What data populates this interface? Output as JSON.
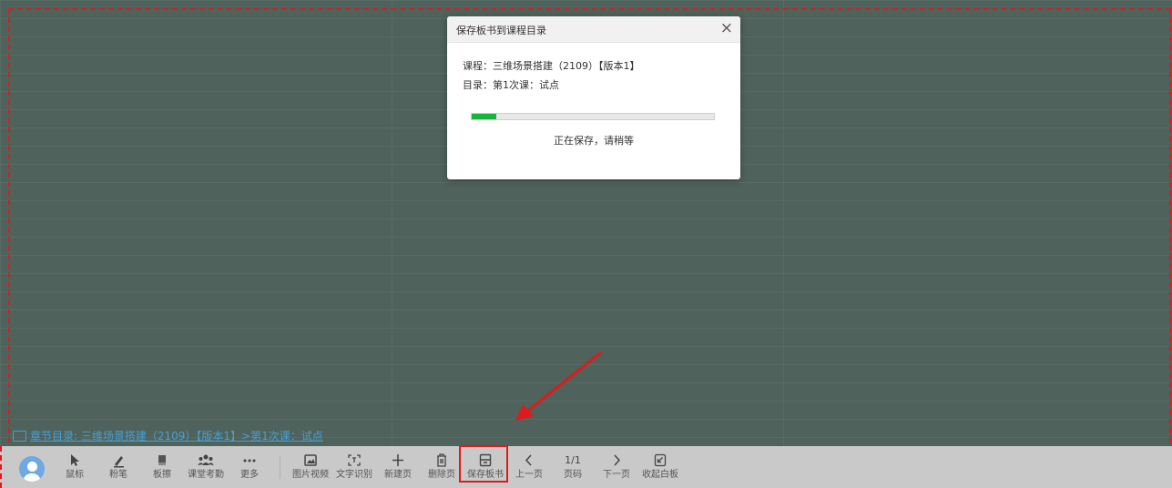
{
  "dialog": {
    "title": "保存板书到课程目录",
    "close_icon": "×",
    "course_line": "课程：三维场景搭建（2109）【版本1】",
    "catalog_line": "目录：第1次课：试点",
    "progress_fraction": 0.1,
    "status_text": "正在保存，请稍等"
  },
  "chapter_link": "章节目录: 三维场景搭建（2109）【版本1】>第1次课：试点",
  "toolbar": {
    "mouse": {
      "icon": "cursor-arrow-icon",
      "label": "鼠标"
    },
    "chalk": {
      "icon": "chalk-pen-icon",
      "label": "粉笔"
    },
    "eraser": {
      "icon": "eraser-icon",
      "label": "板擦"
    },
    "attendance": {
      "icon": "people-icon",
      "label": "课堂考勤"
    },
    "more": {
      "icon": "more-dots-icon",
      "label": "更多"
    },
    "media": {
      "icon": "image-video-icon",
      "label": "图片视频"
    },
    "ocr": {
      "icon": "text-recognition-icon",
      "label": "文字识别"
    },
    "new_page": {
      "icon": "plus-icon",
      "label": "新建页"
    },
    "delete_page": {
      "icon": "trash-icon",
      "label": "删除页"
    },
    "save_board": {
      "icon": "save-disk-icon",
      "label": "保存板书"
    },
    "prev_page": {
      "icon": "chevron-left-icon",
      "label": "上一页"
    },
    "page_number": {
      "value": "1/1",
      "label": "页码"
    },
    "next_page": {
      "icon": "chevron-right-icon",
      "label": "下一页"
    },
    "collapse": {
      "icon": "collapse-board-icon",
      "label": "收起白板"
    }
  },
  "colors": {
    "board_bg": "#4f625c",
    "progress_green": "#18b43a",
    "highlight_red": "#e0191c",
    "link_blue": "#4a9fcf"
  }
}
